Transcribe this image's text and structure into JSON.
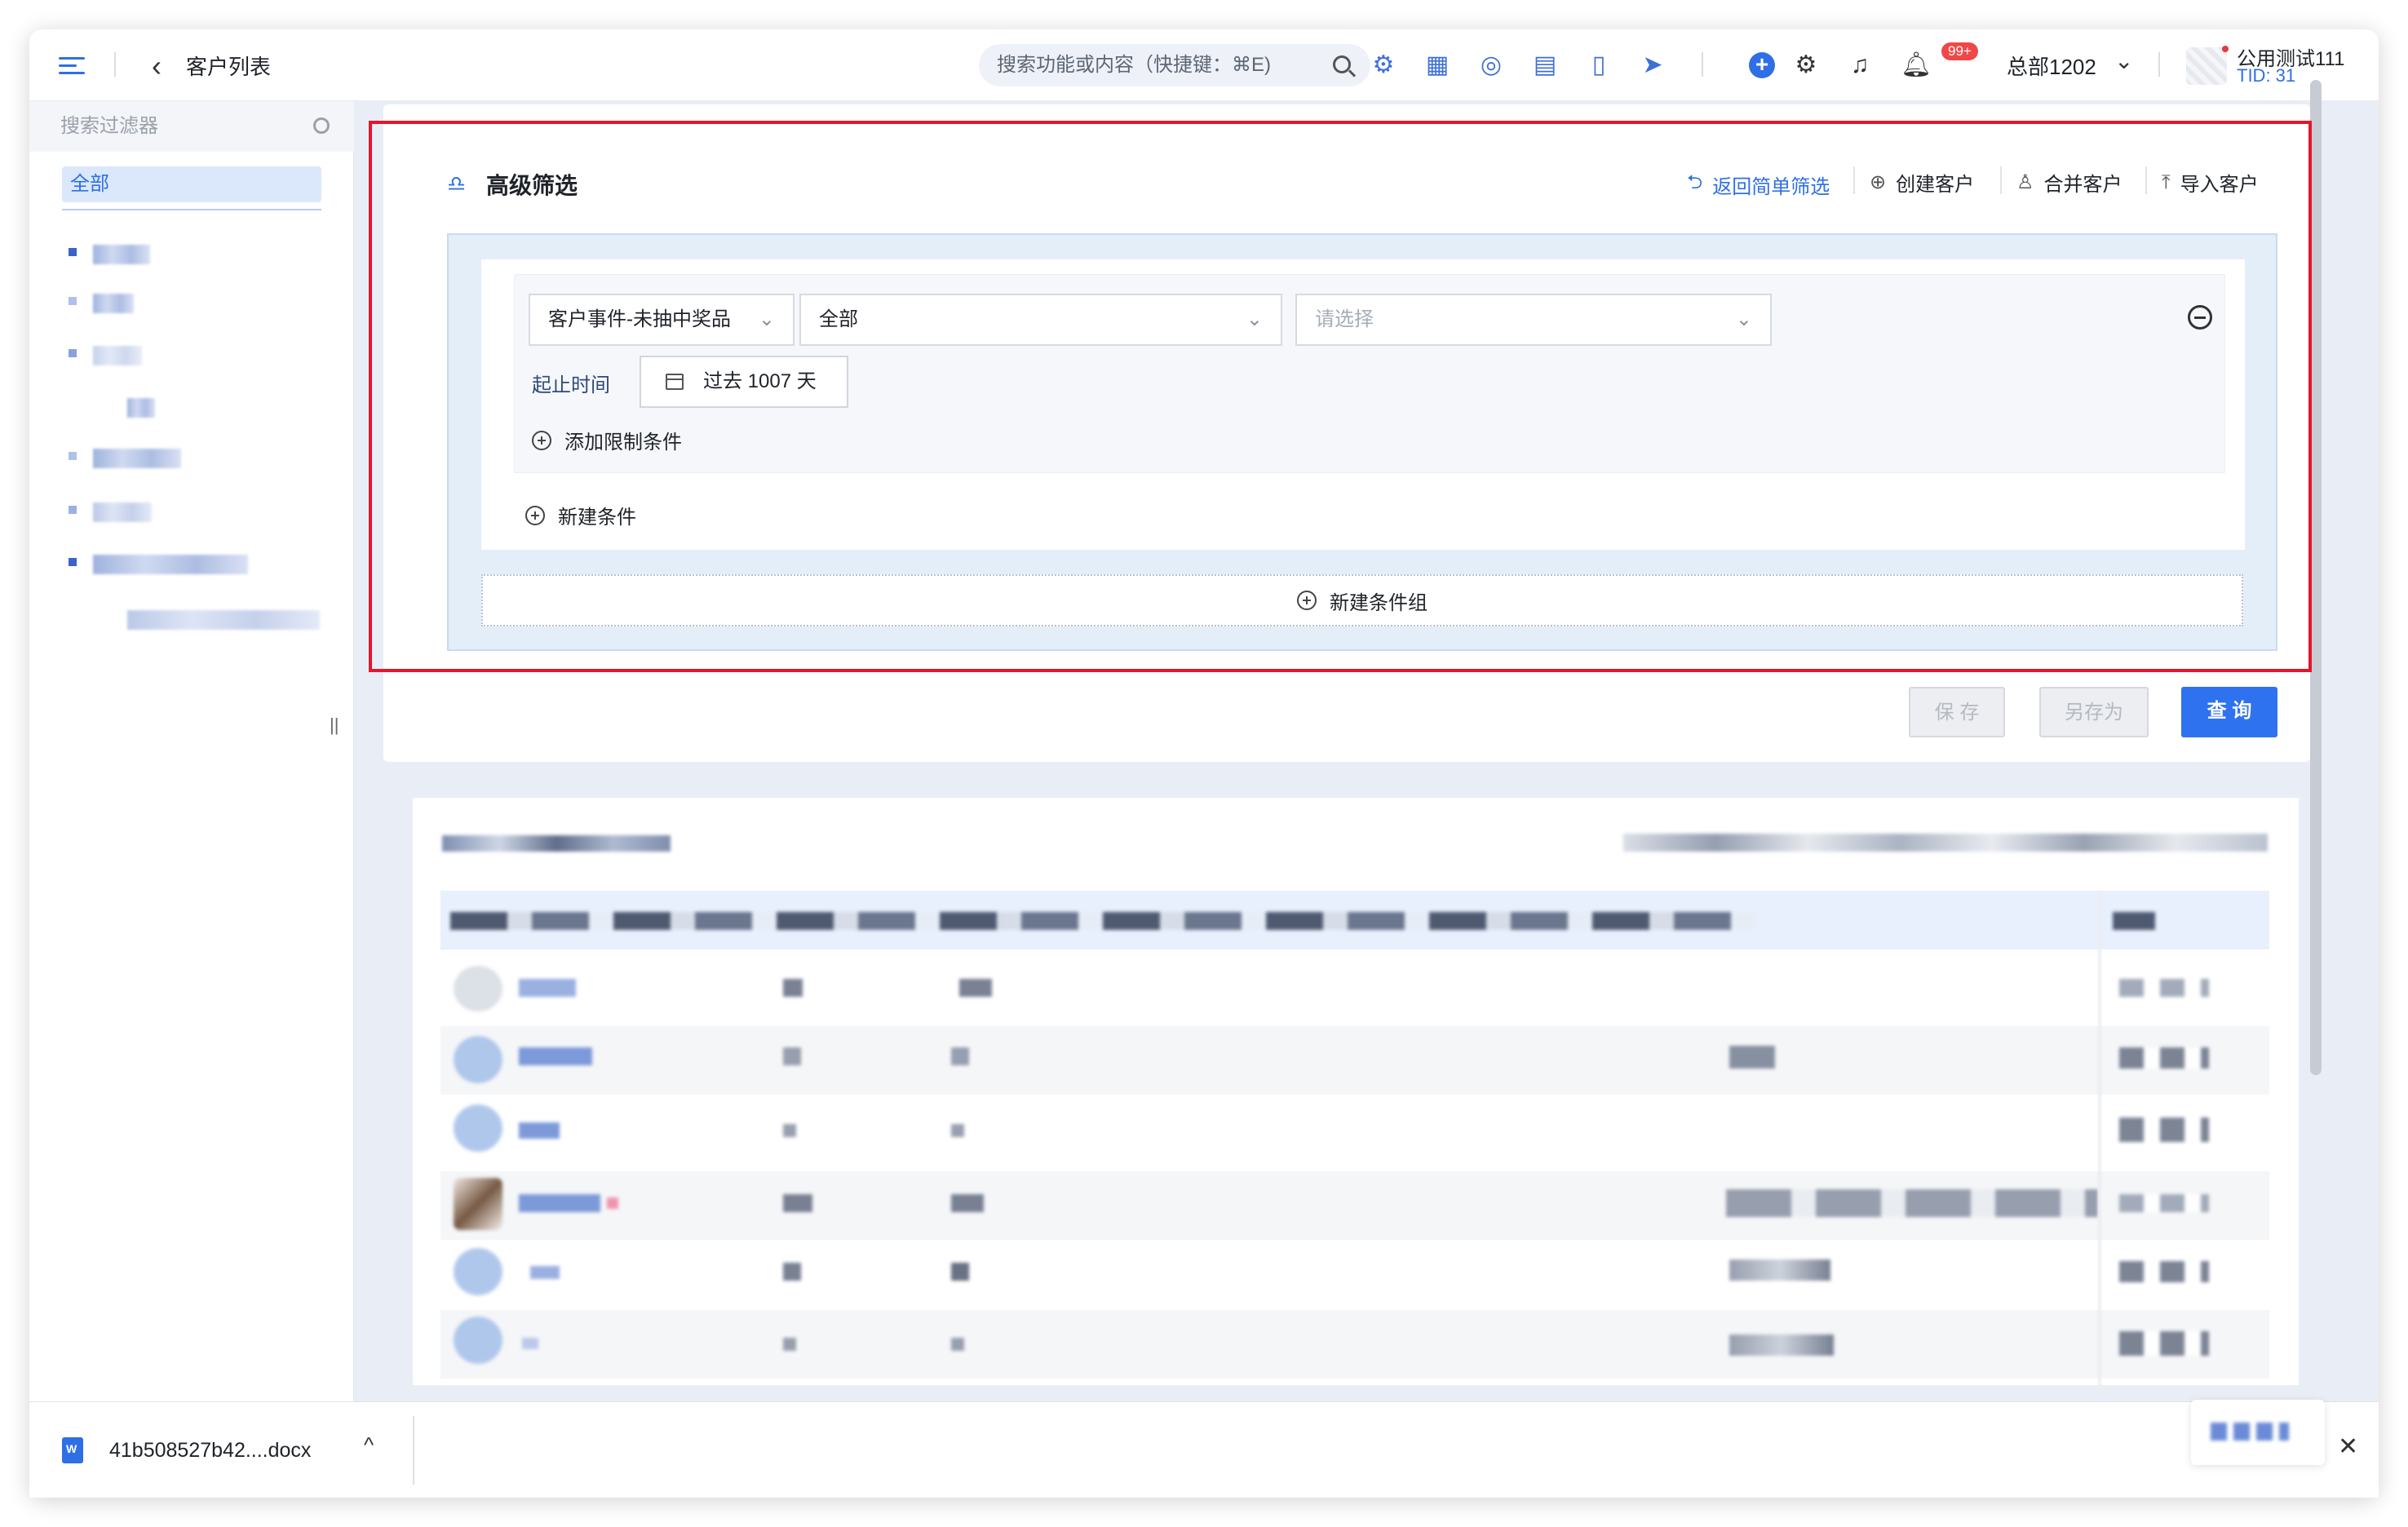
{
  "header": {
    "page_title": "客户列表",
    "search_placeholder": "搜索功能或内容（快捷键：⌘E)",
    "notification_badge": "99+",
    "org_name": "总部1202",
    "user_name": "公用测试111",
    "user_tid": "TID: 31"
  },
  "sidebar": {
    "search_placeholder": "搜索过滤器",
    "all_label": "全部"
  },
  "filter": {
    "title": "高级筛选",
    "actions": {
      "back_simple": "返回简单筛选",
      "create_customer": "创建客户",
      "merge_customer": "合并客户",
      "import_customer": "导入客户"
    },
    "condition": {
      "event_select": "客户事件-未抽中奖品",
      "scope_select": "全部",
      "value_placeholder": "请选择",
      "time_label": "起止时间",
      "time_range": "过去 1007 天",
      "add_restriction": "添加限制条件"
    },
    "new_condition": "新建条件",
    "new_condition_group": "新建条件组"
  },
  "buttons": {
    "save": "保 存",
    "save_as": "另存为",
    "query": "查 询"
  },
  "downloads": {
    "file_name": "41b508527b42....docx"
  },
  "colors": {
    "accent": "#2f72f0",
    "highlight_border": "#e3162d",
    "badge": "#f04848"
  }
}
